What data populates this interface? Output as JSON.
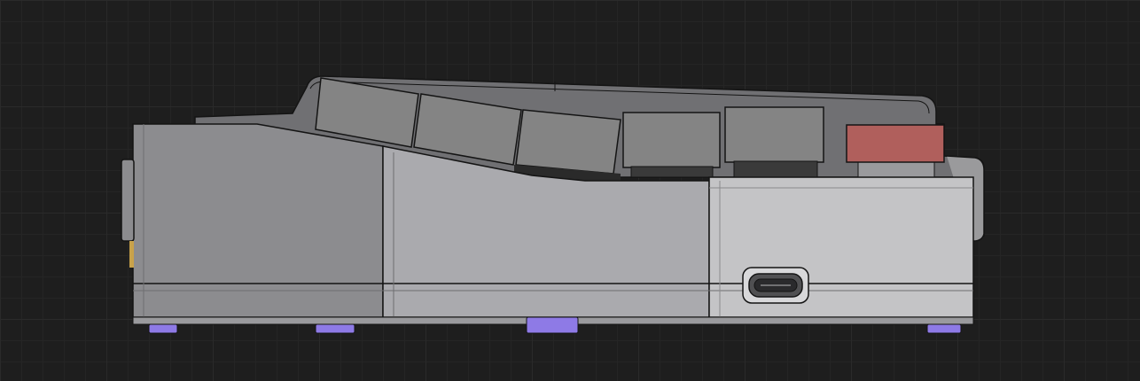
{
  "scene": {
    "view": "side-elevation",
    "object": "keyboard-case-with-keycaps",
    "colors": {
      "background": "#1e1e1e",
      "case_dark": "#8c8c8f",
      "case_mid": "#aaaaae",
      "case_light": "#c4c4c6",
      "keycap": "#848484",
      "accent_keycap": "#b05f5c",
      "feet": "#8e7ae6",
      "outline": "#141414"
    },
    "icons": [
      "usb-c-port-icon"
    ],
    "keycaps": [
      {
        "name": "keycap-1",
        "tilted": true
      },
      {
        "name": "keycap-2",
        "tilted": true
      },
      {
        "name": "keycap-3",
        "tilted": true
      },
      {
        "name": "keycap-4",
        "tilted": false
      },
      {
        "name": "keycap-5",
        "tilted": false
      },
      {
        "name": "keycap-accent",
        "tilted": false,
        "color": "#b05f5c"
      }
    ]
  }
}
